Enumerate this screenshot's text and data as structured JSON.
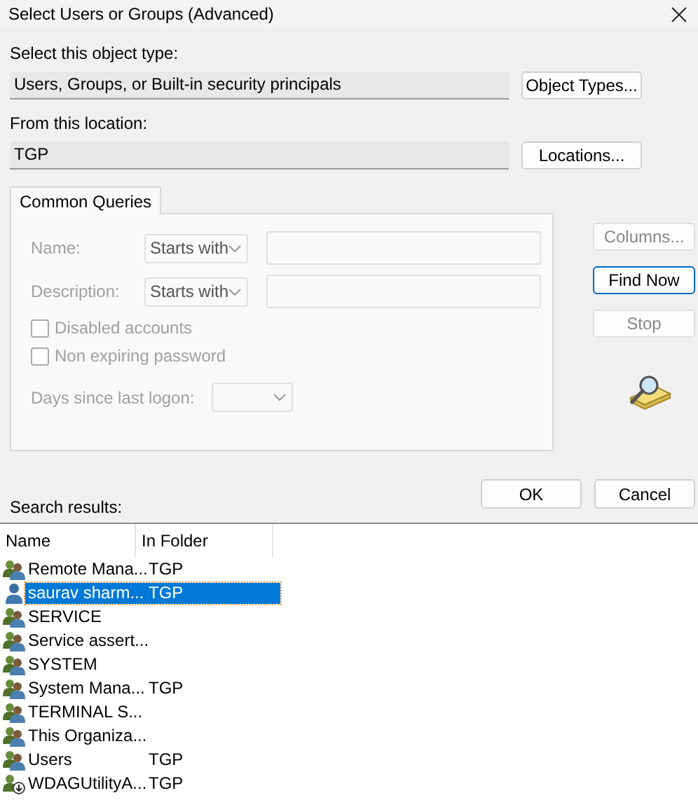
{
  "window": {
    "title": "Select Users or Groups (Advanced)"
  },
  "object_type": {
    "label": "Select this object type:",
    "value": "Users, Groups, or Built-in security principals",
    "button": "Object Types..."
  },
  "location": {
    "label": "From this location:",
    "value": "TGP",
    "button": "Locations..."
  },
  "tabs": [
    {
      "label": "Common Queries",
      "selected": true
    }
  ],
  "query": {
    "disabled": true,
    "fields": [
      {
        "label": "Name:",
        "operator": "Starts with"
      },
      {
        "label": "Description:",
        "operator": "Starts with"
      }
    ],
    "checkboxes": [
      {
        "label": "Disabled accounts",
        "checked": false
      },
      {
        "label": "Non expiring password",
        "checked": false
      }
    ],
    "days_label": "Days since last logon:"
  },
  "side_buttons": [
    {
      "label": "Columns...",
      "disabled": true,
      "default": false
    },
    {
      "label": "Find Now",
      "disabled": false,
      "default": true
    },
    {
      "label": "Stop",
      "disabled": true,
      "default": false
    }
  ],
  "dialog_buttons": [
    "OK",
    "Cancel"
  ],
  "results_label": "Search results:",
  "table": {
    "columns": [
      "Name",
      "In Folder"
    ],
    "rows": [
      {
        "name": "Remote Mana...",
        "folder": "TGP",
        "kind": "group",
        "selected": false
      },
      {
        "name": "saurav sharm...",
        "folder": "TGP",
        "kind": "user",
        "selected": true
      },
      {
        "name": "SERVICE",
        "folder": "",
        "kind": "group",
        "selected": false
      },
      {
        "name": "Service assert...",
        "folder": "",
        "kind": "group",
        "selected": false
      },
      {
        "name": "SYSTEM",
        "folder": "",
        "kind": "group",
        "selected": false
      },
      {
        "name": "System Mana...",
        "folder": "TGP",
        "kind": "group",
        "selected": false
      },
      {
        "name": "TERMINAL S...",
        "folder": "",
        "kind": "group",
        "selected": false
      },
      {
        "name": "This Organiza...",
        "folder": "",
        "kind": "group",
        "selected": false
      },
      {
        "name": "Users",
        "folder": "TGP",
        "kind": "group",
        "selected": false
      },
      {
        "name": "WDAGUtilityA...",
        "folder": "TGP",
        "kind": "disabled-user",
        "selected": false
      }
    ]
  }
}
